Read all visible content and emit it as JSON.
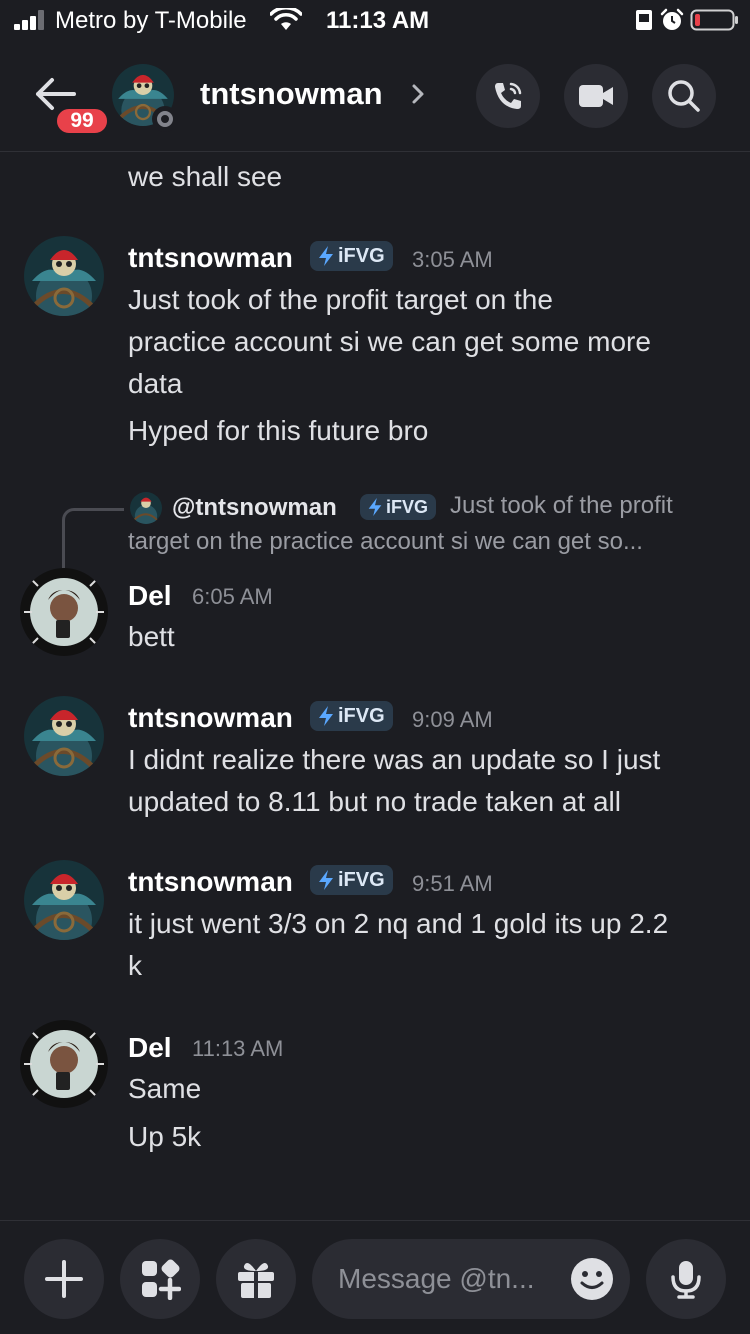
{
  "status_bar": {
    "carrier": "Metro by T-Mobile",
    "time": "11:13 AM"
  },
  "header": {
    "unread_count": "99",
    "channel_name": "tntsnowman"
  },
  "composer": {
    "placeholder": "Message @tn..."
  },
  "messages": [
    {
      "type": "continuation",
      "text": "we shall see"
    },
    {
      "type": "message",
      "author": "tntsnowman",
      "role": "iFVG",
      "time": "3:05 AM",
      "lines": [
        "Just took of the profit target on the",
        "practice account si we can get some more",
        "data"
      ],
      "followup": "Hyped for this future bro"
    },
    {
      "type": "reply",
      "reply_author": "@tntsnowman",
      "reply_role": "iFVG",
      "reply_text_1": "Just took of the profit",
      "reply_text_2": "target on the practice account si we can get so...",
      "author": "Del",
      "time": "6:05 AM",
      "text": "bett"
    },
    {
      "type": "message",
      "author": "tntsnowman",
      "role": "iFVG",
      "time": "9:09 AM",
      "lines": [
        "I didnt realize there was an update so I just",
        "updated to 8.11 but no trade taken at all"
      ]
    },
    {
      "type": "message",
      "author": "tntsnowman",
      "role": "iFVG",
      "time": "9:51 AM",
      "lines": [
        "it just went 3/3 on 2 nq and 1 gold its up 2.2",
        "k"
      ]
    },
    {
      "type": "message",
      "author": "Del",
      "time": "11:13 AM",
      "text": "Same",
      "followup": "Up 5k"
    }
  ],
  "colors": {
    "background": "#1c1d22",
    "badge": "#e8414a",
    "role_tag": "#2a3a4a",
    "role_bolt": "#5aa8ff",
    "battery_low": "#e8414a"
  }
}
